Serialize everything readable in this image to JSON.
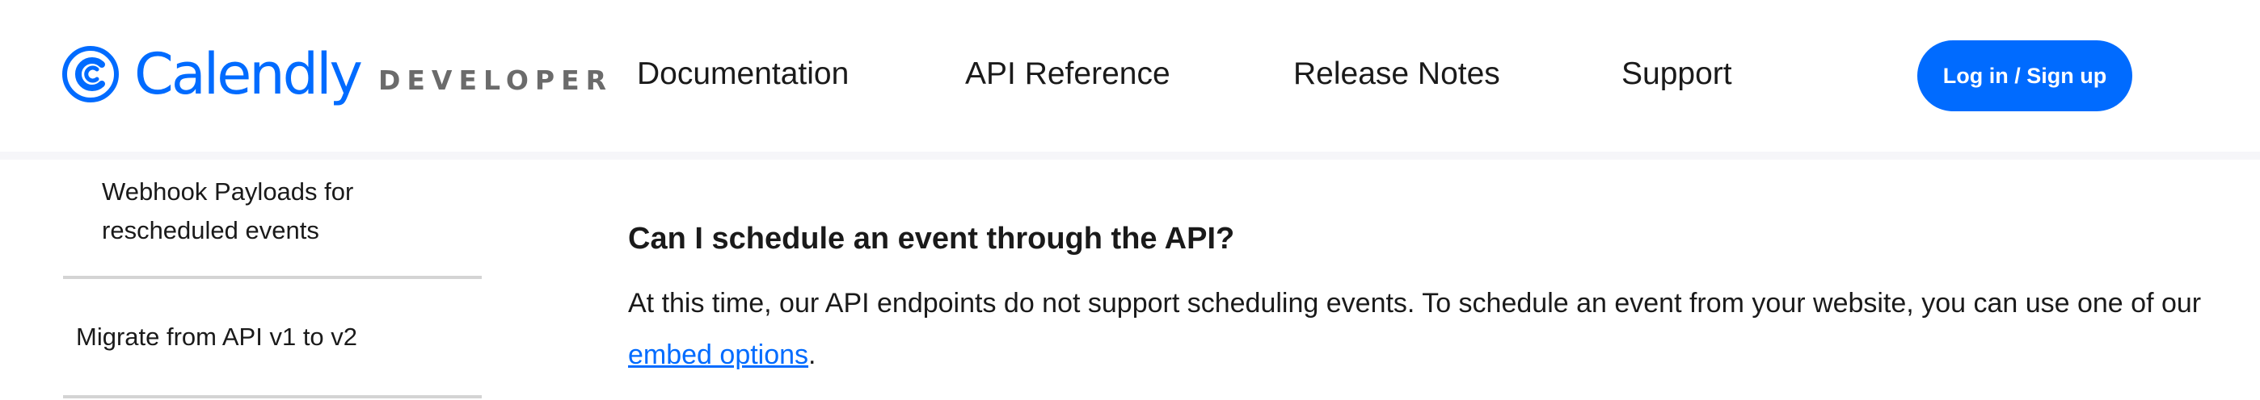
{
  "header": {
    "logo_word": "Calendly",
    "logo_suffix": "DEVELOPER",
    "nav": [
      {
        "label": "Documentation"
      },
      {
        "label": "API Reference"
      },
      {
        "label": "Release Notes"
      },
      {
        "label": "Support"
      }
    ],
    "login_label": "Log in / Sign up",
    "brand_color": "#006bff"
  },
  "sidebar": {
    "sub_item": "Webhook Payloads for rescheduled events",
    "item": "Migrate from API v1 to v2"
  },
  "main": {
    "question": "Can I schedule an event through the API?",
    "answer_before": "At this time, our API endpoints do not support scheduling events. To schedule an event from your website, you can use one of our ",
    "answer_link": "embed options",
    "answer_after": "."
  }
}
